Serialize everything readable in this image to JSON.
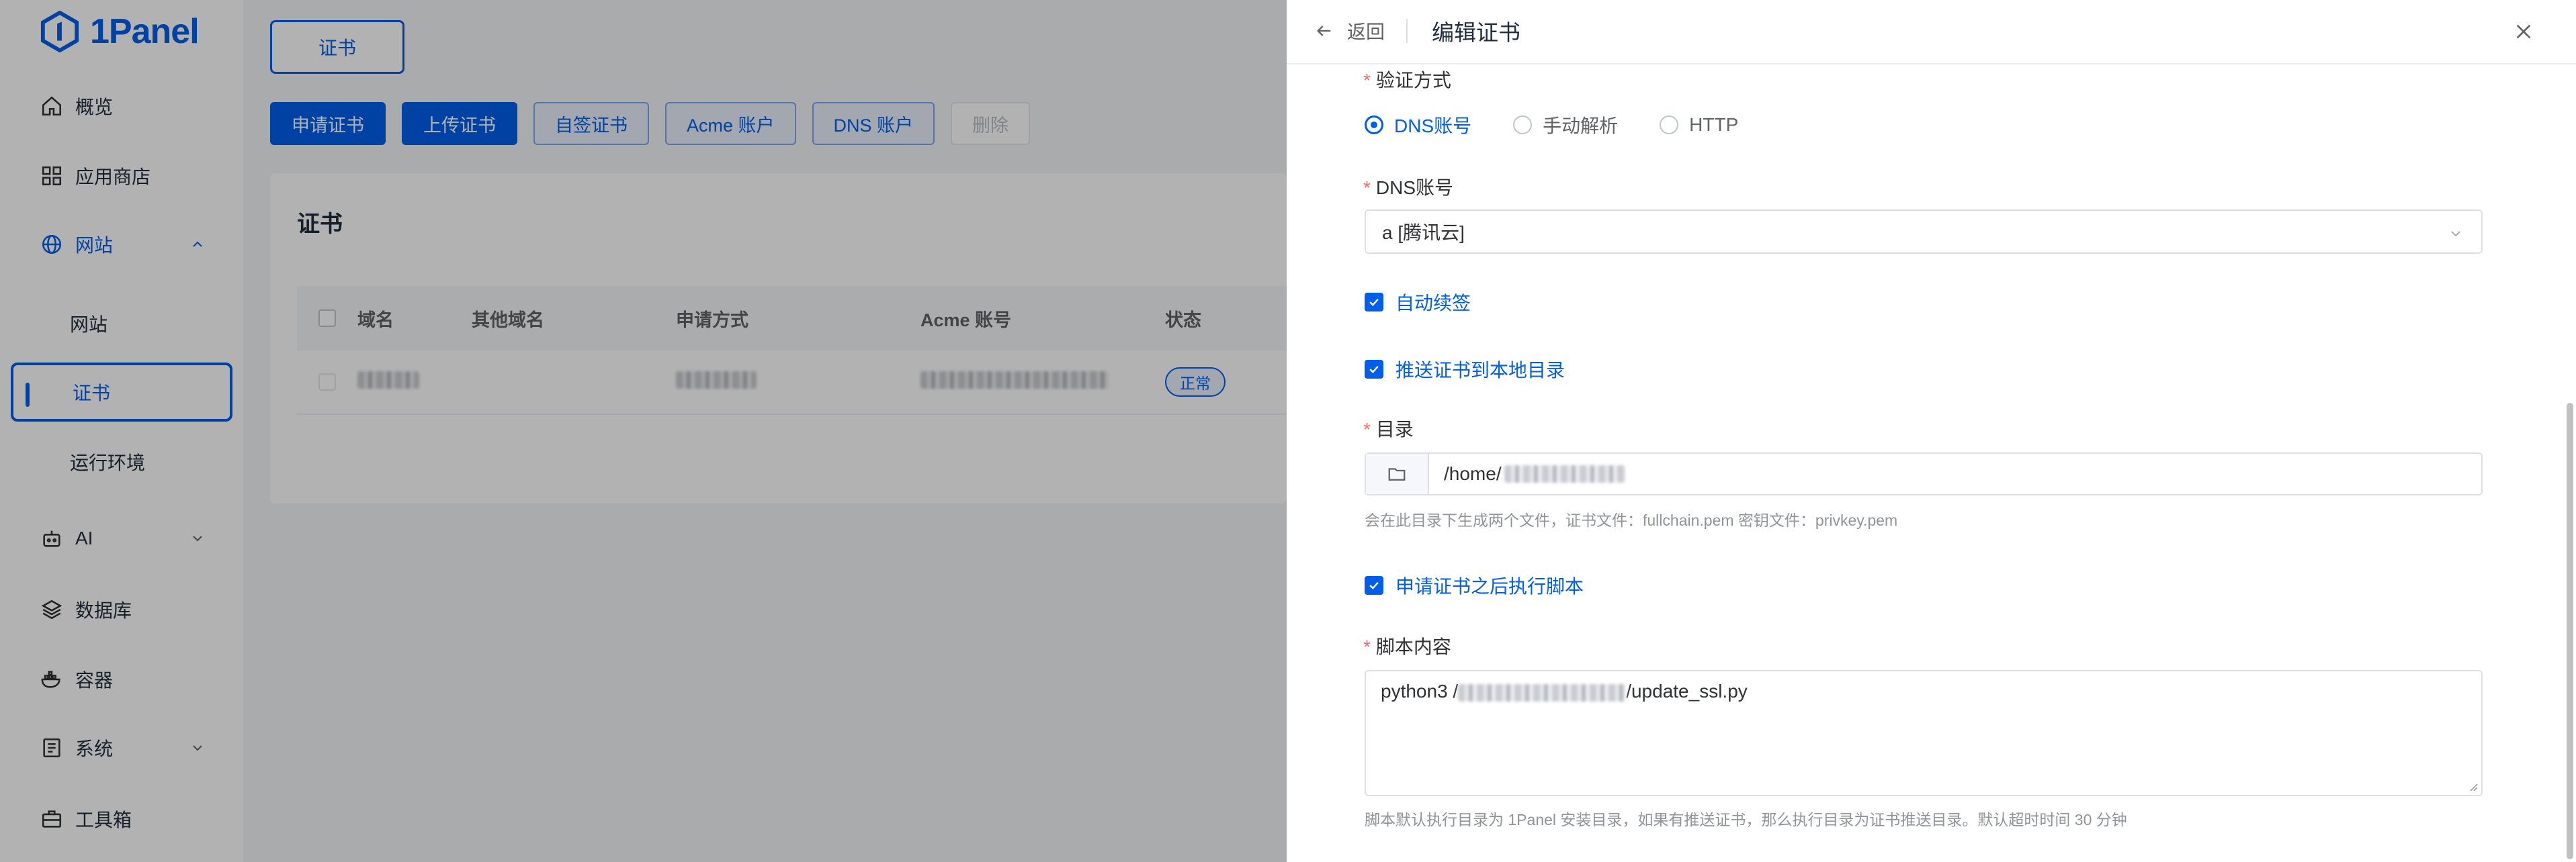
{
  "app": {
    "name": "1Panel"
  },
  "sidebar": {
    "items": [
      {
        "label": "概览",
        "icon": "home-icon"
      },
      {
        "label": "应用商店",
        "icon": "grid-icon"
      },
      {
        "label": "网站",
        "icon": "globe-icon",
        "expanded": true
      },
      {
        "label": "AI",
        "icon": "robot-icon"
      },
      {
        "label": "数据库",
        "icon": "layers-icon"
      },
      {
        "label": "容器",
        "icon": "docker-icon"
      },
      {
        "label": "系统",
        "icon": "system-icon"
      },
      {
        "label": "工具箱",
        "icon": "toolbox-icon"
      }
    ],
    "sub_items": [
      {
        "label": "网站"
      },
      {
        "label": "证书",
        "active": true
      },
      {
        "label": "运行环境"
      }
    ]
  },
  "main": {
    "tab": "证书",
    "toolbar": {
      "apply": "申请证书",
      "upload": "上传证书",
      "self_signed": "自签证书",
      "acme_account": "Acme 账户",
      "dns_account": "DNS 账户",
      "delete": "删除"
    },
    "card_title": "证书",
    "table": {
      "columns": [
        "域名",
        "其他域名",
        "申请方式",
        "Acme 账号",
        "状态"
      ],
      "rows": [
        {
          "status": "正常"
        }
      ]
    }
  },
  "drawer": {
    "back": "返回",
    "title": "编辑证书",
    "verify_method": {
      "label": "验证方式",
      "options": [
        "DNS账号",
        "手动解析",
        "HTTP"
      ],
      "selected": "DNS账号"
    },
    "dns_account": {
      "label": "DNS账号",
      "value": "a [腾讯云]"
    },
    "auto_renew": {
      "label": "自动续签",
      "checked": true
    },
    "push_local": {
      "label": "推送证书到本地目录",
      "checked": true
    },
    "directory": {
      "label": "目录",
      "value": "/home/",
      "help": "会在此目录下生成两个文件，证书文件：fullchain.pem 密钥文件：privkey.pem"
    },
    "exec_script": {
      "label": "申请证书之后执行脚本",
      "checked": true
    },
    "script": {
      "label": "脚本内容",
      "value_prefix": "python3 /",
      "value_suffix": "/update_ssl.py",
      "help": "脚本默认执行目录为 1Panel 安装目录，如果有推送证书，那么执行目录为证书推送目录。默认超时时间 30 分钟"
    }
  },
  "colors": {
    "primary": "#005eeb",
    "required": "#f56c6c",
    "help_text": "#909399"
  }
}
